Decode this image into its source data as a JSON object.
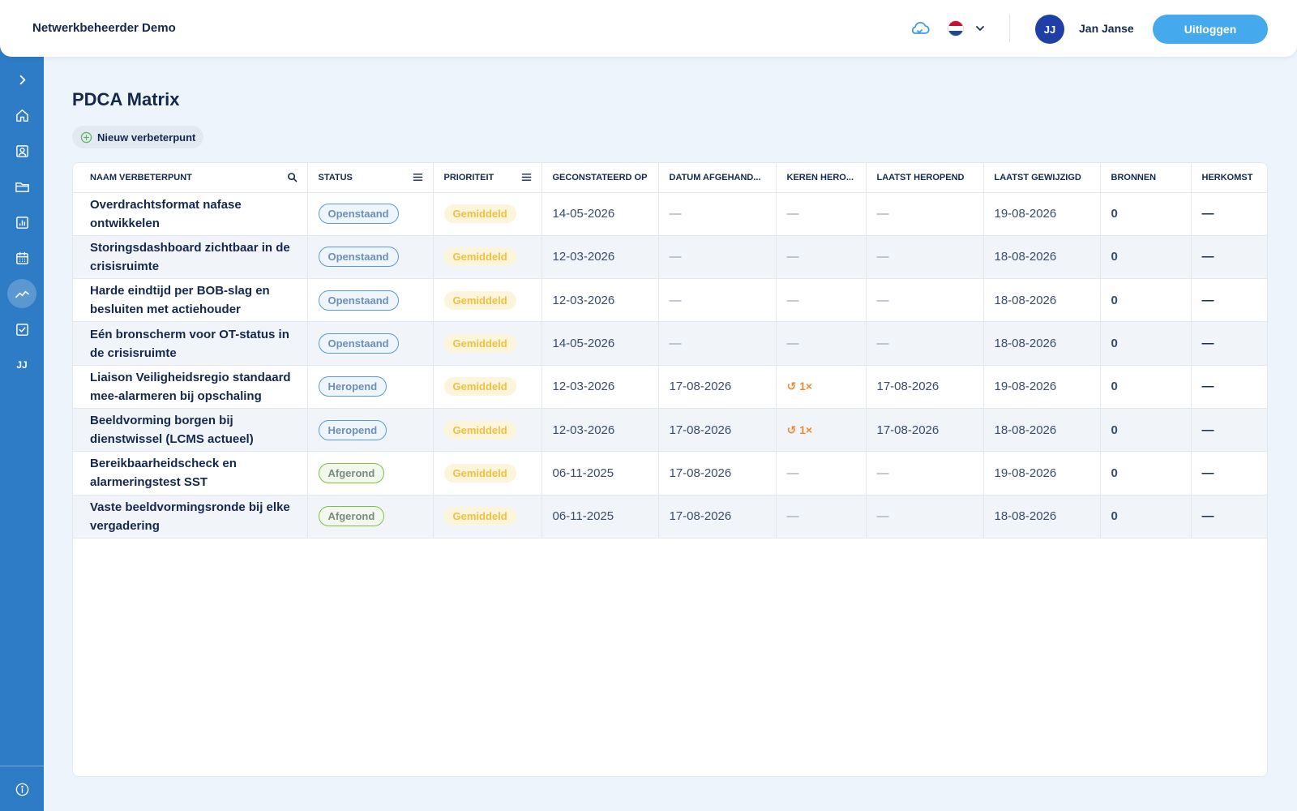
{
  "header": {
    "app_title": "Netwerkbeheerder Demo",
    "language": "nl",
    "user_initials": "JJ",
    "user_name": "Jan Janse",
    "logout_label": "Uitloggen"
  },
  "sidebar": {
    "items": [
      {
        "name": "expand",
        "icon": "chevron-right-icon"
      },
      {
        "name": "home",
        "icon": "home-icon"
      },
      {
        "name": "contacts",
        "icon": "contact-card-icon"
      },
      {
        "name": "documents",
        "icon": "folder-icon"
      },
      {
        "name": "reports",
        "icon": "bar-chart-icon"
      },
      {
        "name": "calendar",
        "icon": "calendar-icon"
      },
      {
        "name": "pdca",
        "icon": "trend-chart-icon",
        "active": true
      },
      {
        "name": "tasks",
        "icon": "checkbox-icon"
      },
      {
        "name": "profile",
        "label": "JJ"
      },
      {
        "name": "info",
        "icon": "info-icon"
      }
    ]
  },
  "main": {
    "title": "PDCA Matrix",
    "new_button_label": "Nieuw verbeterpunt"
  },
  "table": {
    "columns": [
      "NAAM VERBETERPUNT",
      "STATUS",
      "PRIORITEIT",
      "GECONSTATEERD OP",
      "DATUM AFGEHAND...",
      "KEREN HERO...",
      "LAATST HEROPEND",
      "LAATST GEWIJZIGD",
      "BRONNEN",
      "HERKOMST"
    ],
    "rows": [
      {
        "name": "Overdrachtsformat nafase ontwikkelen",
        "status": "Openstaand",
        "priority": "Gemiddeld",
        "found": "14-05-2026",
        "handled": "—",
        "reopened": "—",
        "last_reopened": "—",
        "modified": "19-08-2026",
        "sources": "0",
        "origin": "—"
      },
      {
        "name": "Storingsdashboard zichtbaar in de crisisruimte",
        "status": "Openstaand",
        "priority": "Gemiddeld",
        "found": "12-03-2026",
        "handled": "—",
        "reopened": "—",
        "last_reopened": "—",
        "modified": "18-08-2026",
        "sources": "0",
        "origin": "—"
      },
      {
        "name": "Harde eindtijd per BOB-slag en besluiten met actiehouder",
        "status": "Openstaand",
        "priority": "Gemiddeld",
        "found": "12-03-2026",
        "handled": "—",
        "reopened": "—",
        "last_reopened": "—",
        "modified": "18-08-2026",
        "sources": "0",
        "origin": "—"
      },
      {
        "name": "Eén bronscherm voor OT-status in de crisisruimte",
        "status": "Openstaand",
        "priority": "Gemiddeld",
        "found": "14-05-2026",
        "handled": "—",
        "reopened": "—",
        "last_reopened": "—",
        "modified": "18-08-2026",
        "sources": "0",
        "origin": "—"
      },
      {
        "name": "Liaison Veiligheidsregio standaard mee-alarmeren bij opschaling",
        "status": "Heropend",
        "priority": "Gemiddeld",
        "found": "12-03-2026",
        "handled": "17-08-2026",
        "reopened": "↺ 1×",
        "last_reopened": "17-08-2026",
        "modified": "19-08-2026",
        "sources": "0",
        "origin": "—"
      },
      {
        "name": "Beeldvorming borgen bij dienstwissel (LCMS actueel)",
        "status": "Heropend",
        "priority": "Gemiddeld",
        "found": "12-03-2026",
        "handled": "17-08-2026",
        "reopened": "↺ 1×",
        "last_reopened": "17-08-2026",
        "modified": "18-08-2026",
        "sources": "0",
        "origin": "—"
      },
      {
        "name": "Bereikbaarheidscheck en alarmeringstest SST",
        "status": "Afgerond",
        "priority": "Gemiddeld",
        "found": "06-11-2025",
        "handled": "17-08-2026",
        "reopened": "—",
        "last_reopened": "—",
        "modified": "19-08-2026",
        "sources": "0",
        "origin": "—"
      },
      {
        "name": "Vaste beeldvormingsronde bij elke vergadering",
        "status": "Afgerond",
        "priority": "Gemiddeld",
        "found": "06-11-2025",
        "handled": "17-08-2026",
        "reopened": "—",
        "last_reopened": "—",
        "modified": "18-08-2026",
        "sources": "0",
        "origin": "—"
      }
    ]
  },
  "colors": {
    "sidebar": "#2e7bc6",
    "accent": "#45a9ee",
    "title": "#14284d",
    "priority_text": "#f0c040",
    "reopen_text": "#f08a2c"
  }
}
